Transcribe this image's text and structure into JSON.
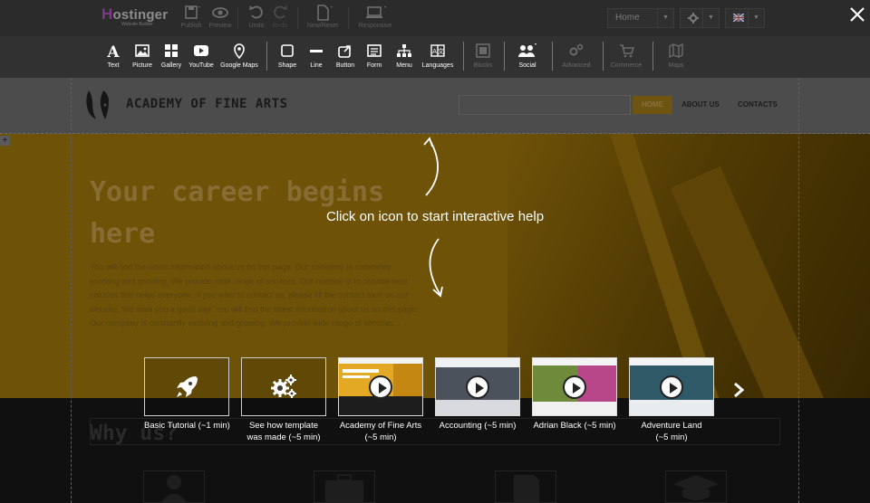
{
  "app": {
    "logo_text": "Hostinger",
    "logo_subtitle": "Website Builder"
  },
  "topbar": {
    "buttons": [
      {
        "label": "Publish",
        "icon": "save-icon"
      },
      {
        "label": "Preview",
        "icon": "eye-icon"
      },
      {
        "label": "Undo",
        "icon": "undo-icon"
      },
      {
        "label": "Redo",
        "icon": "redo-icon"
      },
      {
        "label": "New/Reset",
        "icon": "file-icon"
      },
      {
        "label": "Responsive",
        "icon": "laptop-icon"
      }
    ],
    "page_select": "Home",
    "settings_icon": "gear-icon",
    "language_icon": "uk-flag-icon"
  },
  "tools": [
    {
      "label": "Text",
      "icon": "text-icon",
      "enabled": true
    },
    {
      "label": "Picture",
      "icon": "picture-icon",
      "enabled": true
    },
    {
      "label": "Gallery",
      "icon": "gallery-icon",
      "enabled": true
    },
    {
      "label": "YouTube",
      "icon": "youtube-icon",
      "enabled": true
    },
    {
      "label": "Google Maps",
      "icon": "map-pin-icon",
      "enabled": true
    },
    {
      "label": "Shape",
      "icon": "shape-icon",
      "enabled": true
    },
    {
      "label": "Line",
      "icon": "line-icon",
      "enabled": true
    },
    {
      "label": "Button",
      "icon": "button-icon",
      "enabled": true
    },
    {
      "label": "Form",
      "icon": "form-icon",
      "enabled": true
    },
    {
      "label": "Menu",
      "icon": "menu-icon",
      "enabled": true
    },
    {
      "label": "Languages",
      "icon": "languages-icon",
      "enabled": true
    },
    {
      "label": "Blocks",
      "icon": "blocks-icon",
      "enabled": false
    },
    {
      "label": "Social",
      "icon": "social-icon",
      "enabled": true
    },
    {
      "label": "Advanced",
      "icon": "advanced-icon",
      "enabled": false
    },
    {
      "label": "Commerce",
      "icon": "cart-icon",
      "enabled": false
    },
    {
      "label": "Maps",
      "icon": "maps-icon",
      "enabled": false
    }
  ],
  "site": {
    "brand_name": "ACADEMY OF FINE ARTS",
    "nav": [
      "HOME",
      "ABOUT US",
      "CONTACTS"
    ],
    "hero_title": "Your career begins here",
    "hero_body": "You will find the latest information about us on this page. Our company is constantly evolving and growing. We provide wide range of services. Our mission is to provide best solution that helps everyone. If you want to contact us, please fill the contact form on our website. We wish you a good day! You will find the latest information about us on this page. Our company is constantly evolving and growing. We provide wide range of services...",
    "section_title": "Why us?"
  },
  "help": {
    "text": "Click on icon to start interactive help"
  },
  "tutorials": [
    {
      "title": "Basic Tutorial",
      "duration": "(~1 min)",
      "kind": "rocket-icon"
    },
    {
      "title": "See how template",
      "title2": "was made",
      "duration": "(~5 min)",
      "kind": "gears-icon"
    },
    {
      "title": "Academy of Fine Arts",
      "duration": "(~5 min)",
      "kind": "video"
    },
    {
      "title": "Accounting",
      "duration": "(~5 min)",
      "kind": "video"
    },
    {
      "title": "Adrian Black",
      "duration": "(~5 min)",
      "kind": "video"
    },
    {
      "title": "Adventure Land",
      "duration": "(~5 min)",
      "kind": "video"
    }
  ],
  "colors": {
    "accent_gold": "#6e5208",
    "topbar": "#2b2b2b",
    "toolsbar": "#313131"
  }
}
